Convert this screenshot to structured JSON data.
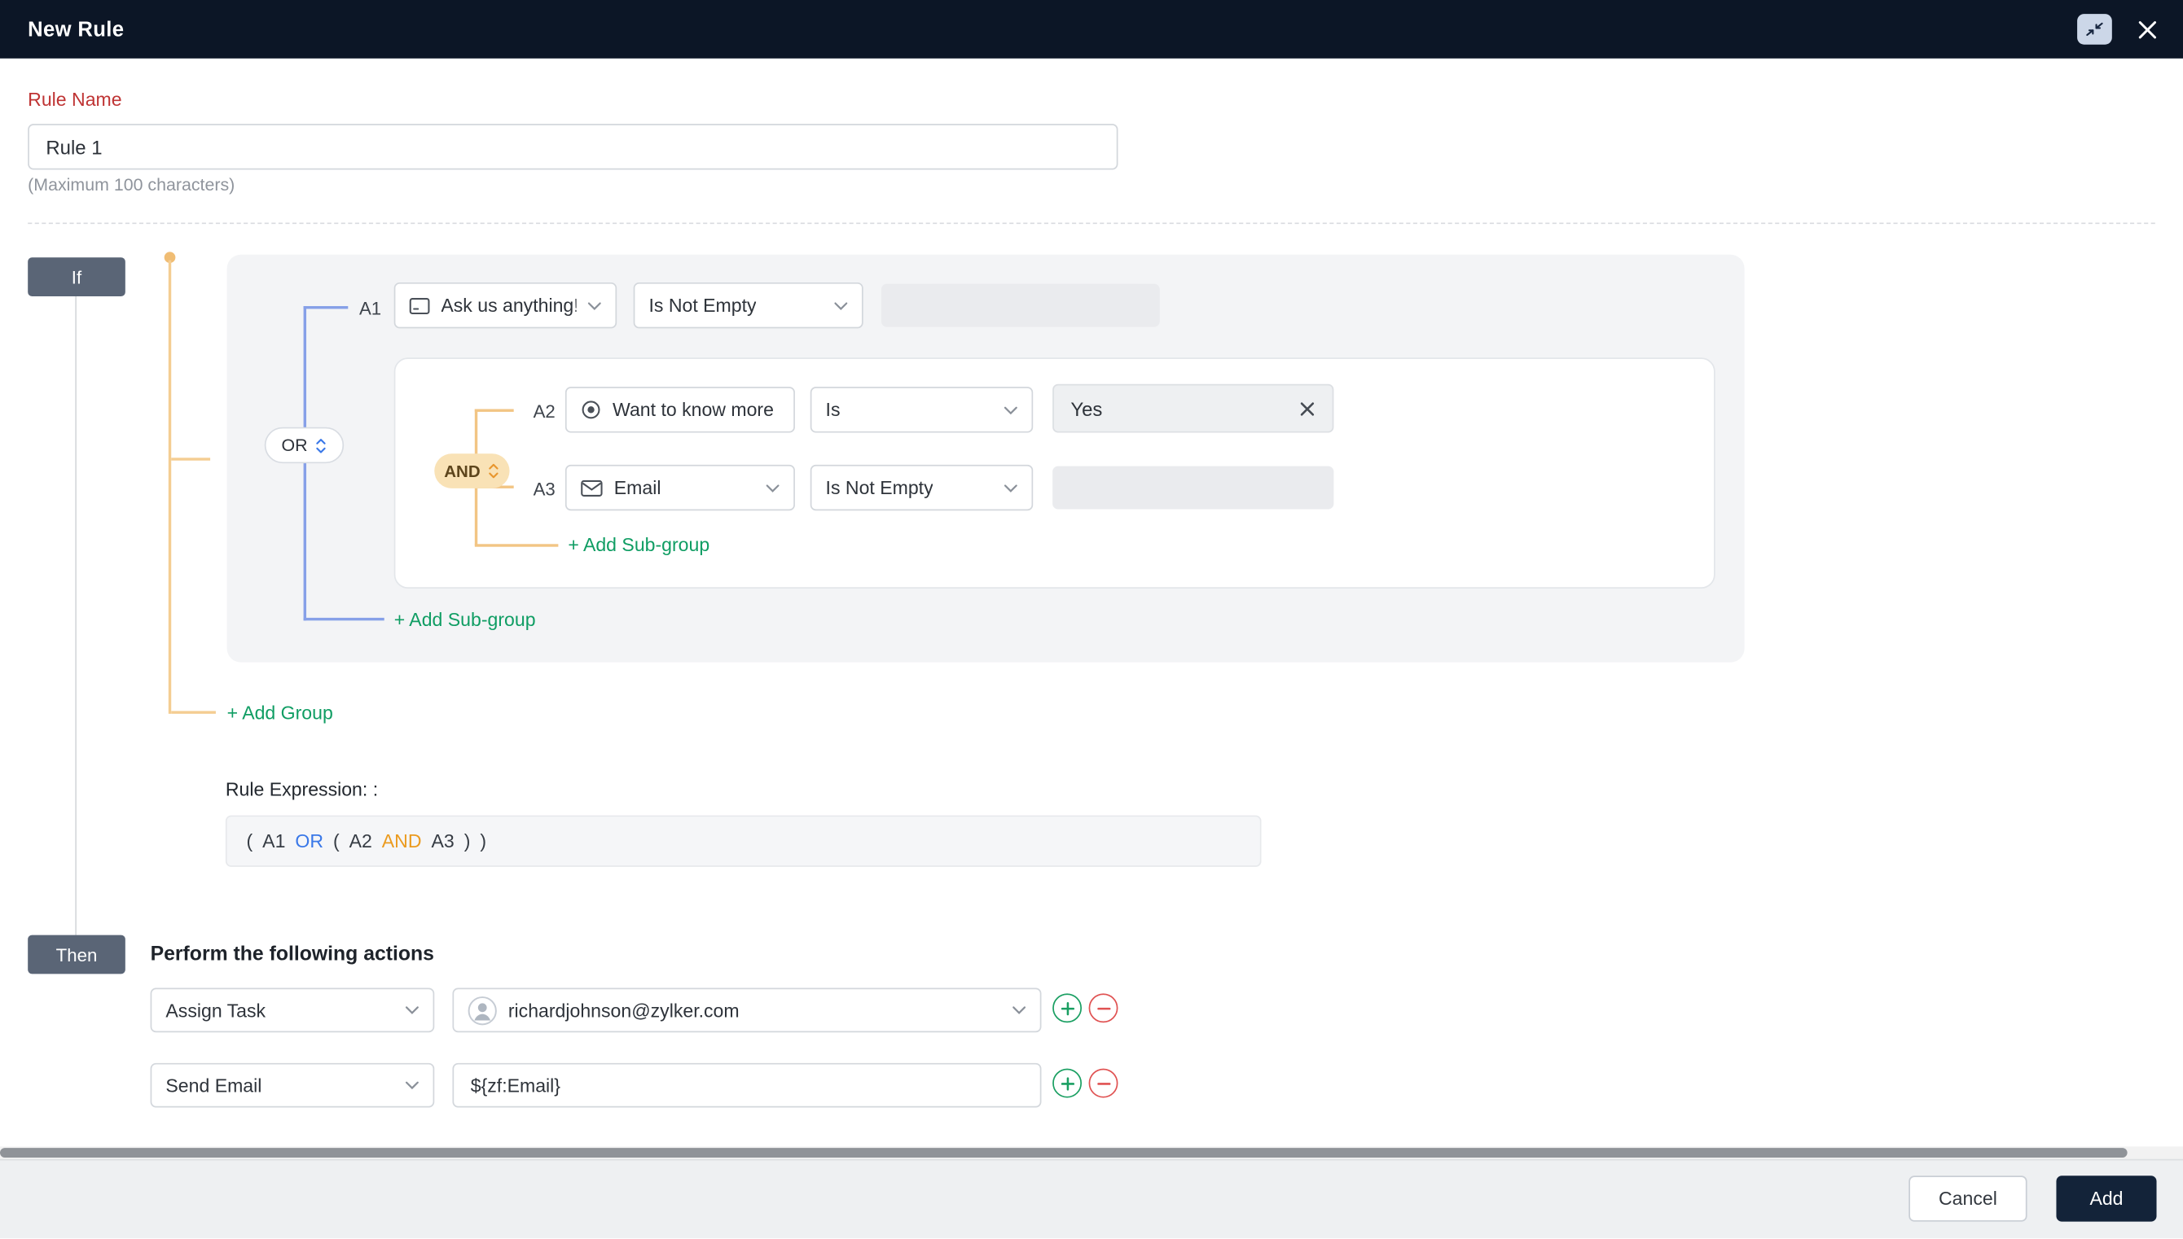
{
  "colors": {
    "header_bg": "#0c1626",
    "required_label_red": "#bf3434",
    "green_link": "#0f9d63",
    "or_blue": "#3a78e8",
    "and_orange": "#eb9b1f",
    "if_then_badge_bg": "#5a6576",
    "add_button_bg": "#132339"
  },
  "icons": {
    "collapse": "diagonal-collapse-arrows",
    "close": "x",
    "chevron_down": "chevron-down",
    "text_field": "text-box",
    "radio": "radio-button",
    "email": "envelope",
    "remove_value": "x",
    "operator_sort": "up-down-chevrons",
    "avatar": "person-circle",
    "add_action": "plus-circle",
    "remove_action": "minus-circle"
  },
  "header": {
    "title": "New Rule"
  },
  "rule_name": {
    "label": "Rule Name",
    "value": "Rule 1",
    "hint": "(Maximum 100 characters)"
  },
  "if_section": {
    "if_label": "If",
    "group": {
      "operator": "OR",
      "row_a1": {
        "id": "A1",
        "field": "Ask us anything!",
        "condition": "Is Not Empty",
        "value": ""
      },
      "subgroup": {
        "operator": "AND",
        "row_a2": {
          "id": "A2",
          "field": "Want to know more",
          "condition": "Is",
          "value": "Yes"
        },
        "row_a3": {
          "id": "A3",
          "field": "Email",
          "condition": "Is Not Empty",
          "value": ""
        },
        "add_subgroup_label": "+ Add Sub-group"
      },
      "add_subgroup_label": "+ Add Sub-group"
    },
    "add_group_label": "+ Add Group",
    "expression_label": "Rule Expression: :",
    "expression_tokens": [
      "(",
      "A1",
      "OR",
      "(",
      "A2",
      "AND",
      "A3",
      ")",
      ")"
    ]
  },
  "then_section": {
    "then_label": "Then",
    "heading": "Perform the following actions",
    "actions": [
      {
        "type": "Assign Task",
        "value": "richardjohnson@zylker.com"
      },
      {
        "type": "Send Email",
        "value": "${zf:Email}"
      }
    ]
  },
  "footer": {
    "cancel_label": "Cancel",
    "add_label": "Add"
  }
}
